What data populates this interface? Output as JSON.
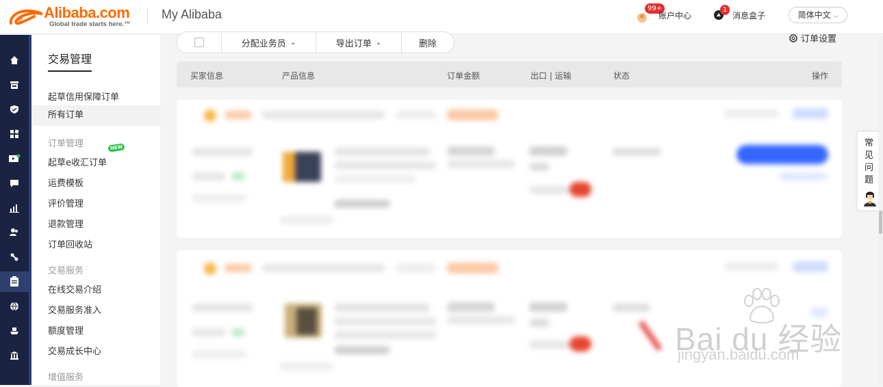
{
  "header": {
    "logo_text": "Alibaba.com",
    "logo_tagline": "Global trade starts here.™",
    "title": "My Alibaba",
    "account_label": "账户中心",
    "account_badge": "99+",
    "message_label": "消息盒子",
    "message_badge": "1",
    "language": "简体中文"
  },
  "sidebar": {
    "title": "交易管理",
    "items": [
      {
        "label": "起草信用保障订单"
      },
      {
        "label": "所有订单"
      }
    ],
    "groups": [
      {
        "title": "订单管理",
        "items": [
          "起草e收汇订单",
          "运费模板",
          "评价管理",
          "退款管理",
          "订单回收站"
        ],
        "badge": "NEW"
      },
      {
        "title": "交易服务",
        "items": [
          "在线交易介绍",
          "交易服务准入",
          "额度管理",
          "交易成长中心"
        ]
      },
      {
        "title": "增值服务",
        "items": []
      }
    ]
  },
  "toolbar": {
    "assign_label": "分配业务员",
    "export_label": "导出订单",
    "delete_label": "删除",
    "settings_label": "订单设置"
  },
  "table": {
    "headers": [
      "买家信息",
      "产品信息",
      "订单金额",
      "出口 | 运输",
      "状态",
      "操作"
    ]
  },
  "faq_tab": "常见问题",
  "watermark": {
    "main": "Bai du 经验",
    "sub": "jingyan.baidu.com"
  },
  "colors": {
    "accent": "#ff6a00",
    "rail": "#1a2341",
    "badge": "#e62e2e",
    "primary_btn": "#3366ff"
  }
}
